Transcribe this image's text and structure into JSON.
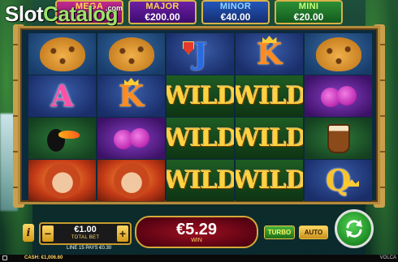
{
  "logo": {
    "text_a": "Slot",
    "text_b": "Catalog",
    "suffix": ".com"
  },
  "jackpots": [
    {
      "name": "MEGA",
      "value": ""
    },
    {
      "name": "MAJOR",
      "value": "€200.00"
    },
    {
      "name": "MINOR",
      "value": "€40.00"
    },
    {
      "name": "MINI",
      "value": "€20.00"
    }
  ],
  "reels": [
    [
      "jaguar",
      "letter-A",
      "toucan",
      "woman"
    ],
    [
      "jaguar",
      "letter-K",
      "orchid",
      "woman"
    ],
    [
      "letter-J",
      "WILD",
      "WILD",
      "WILD"
    ],
    [
      "letter-K",
      "WILD",
      "WILD",
      "WILD"
    ],
    [
      "jaguar",
      "orchid",
      "drum",
      "letter-Q"
    ]
  ],
  "symbols": {
    "wild": "WILD",
    "a": "A",
    "k": "K",
    "j": "J",
    "q": "Q"
  },
  "controls": {
    "info": "i",
    "minus": "−",
    "plus": "+",
    "bet_value": "€1.00",
    "bet_label": "TOTAL BET",
    "line_info": "LINE 15 PAYS €0.30",
    "win_value": "€5.29",
    "win_label": "WIN",
    "turbo": "TURBO",
    "auto": "AUTO"
  },
  "status": {
    "cash": "CASH: €1,006.60",
    "brand": "VOLCA"
  },
  "colors": {
    "wild_gold": "#ffd23f",
    "frame_gold": "#b58a3c",
    "spin_green": "#1e8a23",
    "win_red": "#9e1020"
  }
}
